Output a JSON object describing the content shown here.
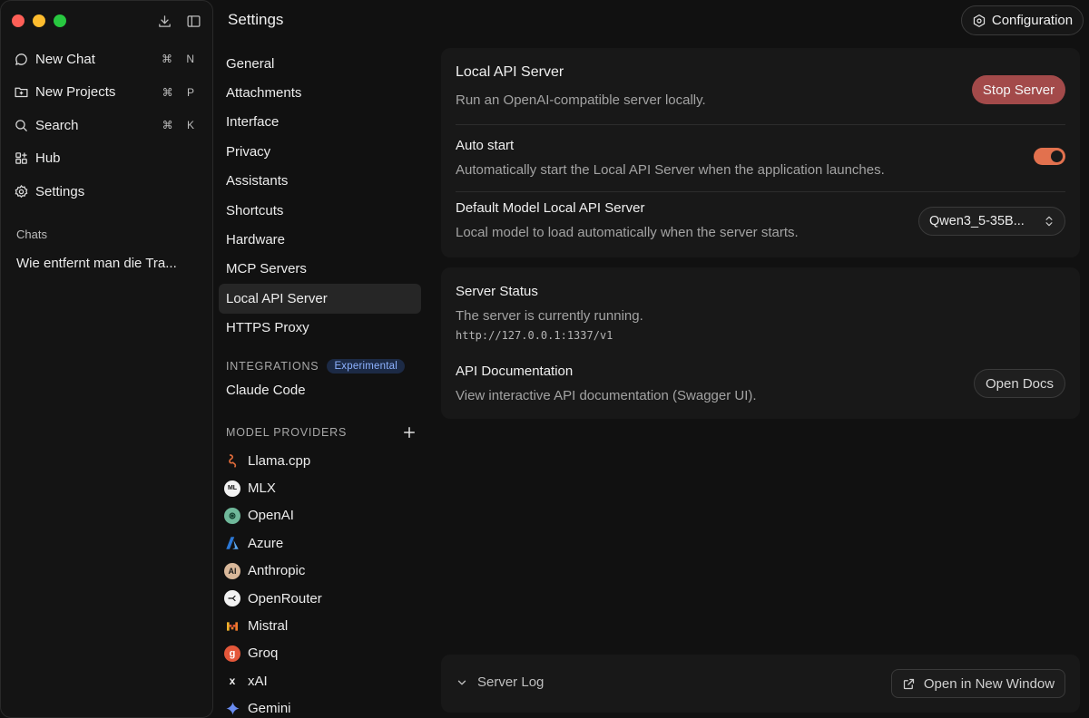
{
  "page": {
    "title": "Settings"
  },
  "header": {
    "config_label": "Configuration"
  },
  "sidebar": {
    "items": [
      {
        "label": "New Chat",
        "shortcut": "⌘ N",
        "icon": "chat-bubble-icon"
      },
      {
        "label": "New Projects",
        "shortcut": "⌘ P",
        "icon": "folder-plus-icon"
      },
      {
        "label": "Search",
        "shortcut": "⌘ K",
        "icon": "search-icon"
      },
      {
        "label": "Hub",
        "shortcut": "",
        "icon": "grid-plus-icon"
      },
      {
        "label": "Settings",
        "shortcut": "",
        "icon": "gear-icon"
      }
    ],
    "chats_label": "Chats",
    "chats": [
      "Wie entfernt man die Tra..."
    ]
  },
  "settings_menu": {
    "items": [
      "General",
      "Attachments",
      "Interface",
      "Privacy",
      "Assistants",
      "Shortcuts",
      "Hardware",
      "MCP Servers",
      "Local API Server",
      "HTTPS Proxy"
    ],
    "active": "Local API Server",
    "integrations_label": "INTEGRATIONS",
    "integrations_badge": "Experimental",
    "integrations_items": [
      "Claude Code"
    ],
    "providers_label": "MODEL PROVIDERS",
    "providers": [
      {
        "name": "Llama.cpp",
        "icon": "llama-icon",
        "color": "#e06b3a"
      },
      {
        "name": "MLX",
        "icon": "mlx-icon",
        "color": "#f2f2f2"
      },
      {
        "name": "OpenAI",
        "icon": "openai-icon",
        "color": "#6fb89a"
      },
      {
        "name": "Azure",
        "icon": "azure-icon",
        "color": "#3a8ee6"
      },
      {
        "name": "Anthropic",
        "icon": "anthropic-icon",
        "color": "#d9b89a"
      },
      {
        "name": "OpenRouter",
        "icon": "openrouter-icon",
        "color": "#f2f2f2"
      },
      {
        "name": "Mistral",
        "icon": "mistral-icon",
        "color": "#f07a2a"
      },
      {
        "name": "Groq",
        "icon": "groq-icon",
        "color": "#e4573a"
      },
      {
        "name": "xAI",
        "icon": "xai-icon",
        "color": "#f2f2f2"
      },
      {
        "name": "Gemini",
        "icon": "gemini-icon",
        "color": "#6a8cf0"
      }
    ]
  },
  "local_api": {
    "title": "Local API Server",
    "desc": "Run an OpenAI-compatible server locally.",
    "stop_label": "Stop Server",
    "auto_start_title": "Auto start",
    "auto_start_desc": "Automatically start the Local API Server when the application launches.",
    "auto_start_enabled": true,
    "default_model_title": "Default Model Local API Server",
    "default_model_desc": "Local model to load automatically when the server starts.",
    "default_model_value": "Qwen3_5-35B...",
    "accent_color": "#e2714e"
  },
  "status": {
    "title": "Server Status",
    "desc": "The server is currently running.",
    "url": "http://127.0.0.1:1337/v1",
    "docs_title": "API Documentation",
    "docs_desc": "View interactive API documentation (Swagger UI).",
    "docs_button": "Open Docs"
  },
  "log": {
    "label": "Server Log",
    "new_window_label": "Open in New Window"
  }
}
